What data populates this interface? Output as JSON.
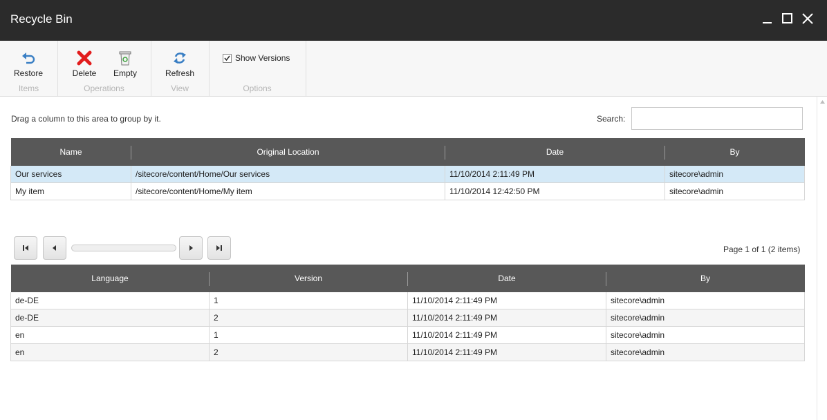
{
  "window": {
    "title": "Recycle Bin"
  },
  "ribbon": {
    "groups": [
      {
        "label": "Items",
        "buttons": [
          {
            "label": "Restore"
          }
        ]
      },
      {
        "label": "Operations",
        "buttons": [
          {
            "label": "Delete"
          },
          {
            "label": "Empty"
          }
        ]
      },
      {
        "label": "View",
        "buttons": [
          {
            "label": "Refresh"
          }
        ]
      },
      {
        "label": "Options",
        "checkbox": {
          "label": "Show Versions",
          "checked": true
        }
      }
    ]
  },
  "grouping_hint": "Drag a column to this area to group by it.",
  "search": {
    "label": "Search:",
    "value": ""
  },
  "items_table": {
    "columns": [
      "Name",
      "Original Location",
      "Date",
      "By"
    ],
    "rows": [
      [
        "Our services",
        "/sitecore/content/Home/Our services",
        "11/10/2014 2:11:49 PM",
        "sitecore\\admin"
      ],
      [
        "My item",
        "/sitecore/content/Home/My item",
        "11/10/2014 12:42:50 PM",
        "sitecore\\admin"
      ]
    ],
    "selected_row": 0
  },
  "pager": {
    "info": "Page 1 of 1 (2 items)"
  },
  "versions_table": {
    "columns": [
      "Language",
      "Version",
      "Date",
      "By"
    ],
    "rows": [
      [
        "de-DE",
        "1",
        "11/10/2014 2:11:49 PM",
        "sitecore\\admin"
      ],
      [
        "de-DE",
        "2",
        "11/10/2014 2:11:49 PM",
        "sitecore\\admin"
      ],
      [
        "en",
        "1",
        "11/10/2014 2:11:49 PM",
        "sitecore\\admin"
      ],
      [
        "en",
        "2",
        "11/10/2014 2:11:49 PM",
        "sitecore\\admin"
      ]
    ]
  },
  "colors": {
    "titlebar": "#2b2b2b",
    "header": "#585858",
    "selected_row": "#d4e9f7",
    "delete_red": "#e21c1c",
    "icon_blue": "#3a7fc4"
  }
}
